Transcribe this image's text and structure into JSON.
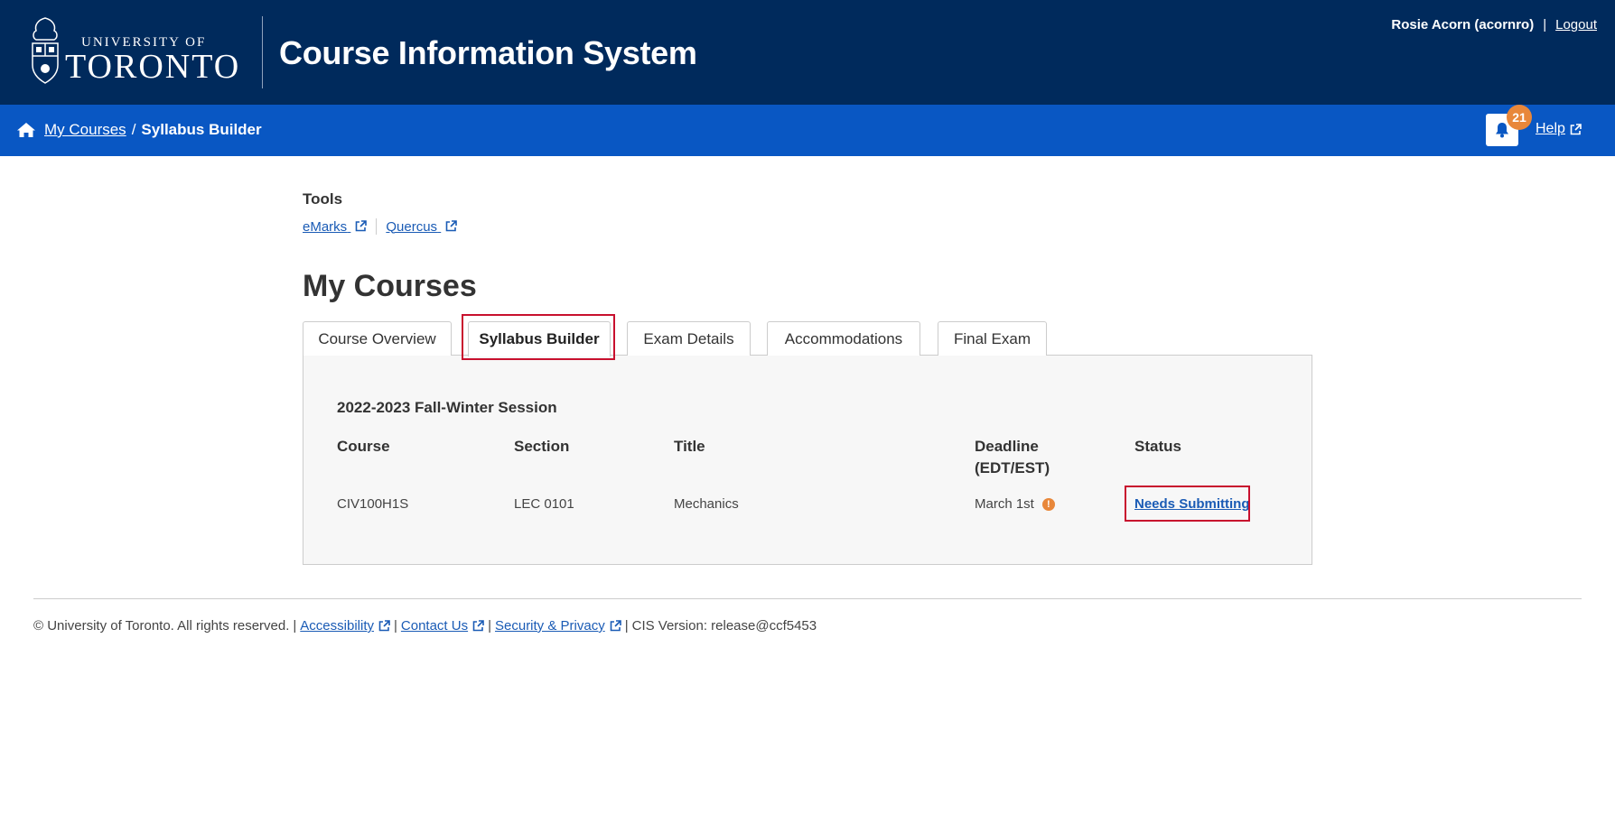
{
  "header": {
    "org_line1": "UNIVERSITY OF",
    "org_line2": "TORONTO",
    "app_title": "Course Information System",
    "user": "Rosie Acorn (acornro)",
    "separator": "|",
    "logout_label": "Logout",
    "background_color": "#002a5c"
  },
  "navbar": {
    "background_color": "#0957c3",
    "breadcrumb": {
      "home_icon": "home-icon",
      "link_label": "My Courses",
      "separator": "/",
      "current": "Syllabus Builder"
    },
    "notifications": {
      "icon": "bell-icon",
      "count": "21",
      "badge_color": "#e8873a"
    },
    "help_label": "Help"
  },
  "tools": {
    "heading": "Tools",
    "links": [
      {
        "label": "eMarks",
        "icon": "external-link-icon"
      },
      {
        "label": "Quercus",
        "icon": "external-link-icon"
      }
    ]
  },
  "main": {
    "title": "My Courses",
    "tabs": [
      {
        "label": "Course Overview",
        "active": false
      },
      {
        "label": "Syllabus Builder",
        "active": true
      },
      {
        "label": "Exam Details",
        "active": false
      },
      {
        "label": "Accommodations",
        "active": false
      },
      {
        "label": "Final Exam",
        "active": false
      }
    ],
    "session": "2022-2023 Fall-Winter Session",
    "columns": {
      "course": "Course",
      "section": "Section",
      "title": "Title",
      "deadline_line1": "Deadline",
      "deadline_line2": "(EDT/EST)",
      "status": "Status"
    },
    "rows": [
      {
        "course": "CIV100H1S",
        "section": "LEC 0101",
        "title": "Mechanics",
        "deadline": "March 1st",
        "deadline_icon": "exclamation-icon",
        "info_glyph": "!",
        "status": "Needs Submitting"
      }
    ],
    "highlight_color": "#c8102e"
  },
  "footer": {
    "copyright": "© University of Toronto. All rights reserved.",
    "sep": "|",
    "links": [
      "Accessibility",
      "Contact Us",
      "Security & Privacy"
    ],
    "version": "CIS Version: release@ccf5453"
  }
}
